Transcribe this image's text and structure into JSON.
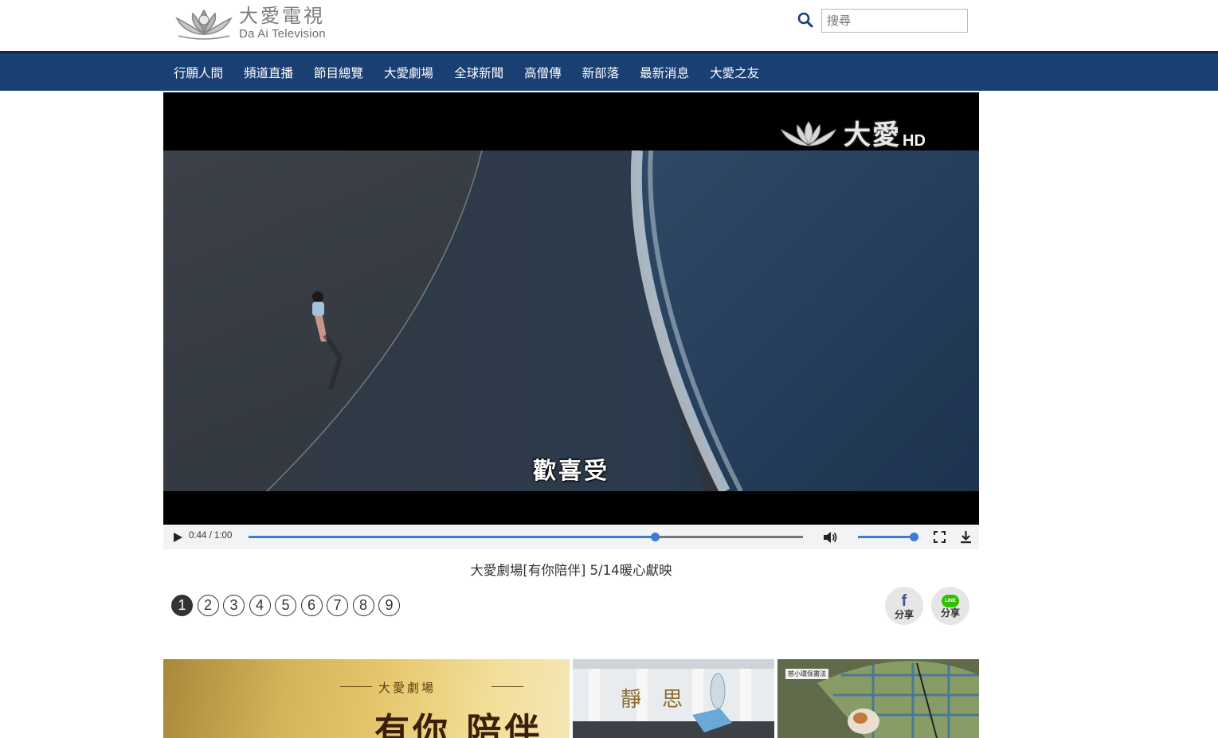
{
  "brand": {
    "name_cn": "大愛電視",
    "name_en": "Da Ai Television"
  },
  "search": {
    "placeholder": "搜尋"
  },
  "nav": {
    "items": [
      "行願人間",
      "頻道直播",
      "節目總覽",
      "大愛劇場",
      "全球新聞",
      "高僧傳",
      "新部落",
      "最新消息",
      "大愛之友"
    ]
  },
  "video": {
    "logo_cn": "大愛",
    "logo_tag": "HD",
    "subtitle": "歡喜受",
    "time_display": "0:44 / 1:00",
    "progress": 0.733,
    "volume": 1.0
  },
  "caption": "大愛劇場[有你陪伴] 5/14暖心獻映",
  "pager": {
    "pages": [
      "1",
      "2",
      "3",
      "4",
      "5",
      "6",
      "7",
      "8",
      "9"
    ],
    "active_index": 0
  },
  "share": {
    "facebook_label": "分享",
    "line_label": "分享",
    "line_badge": "LINE"
  },
  "thumbs": {
    "t1_sub": "大愛劇場",
    "t1_title": "有你 陪伴",
    "t2_sign": "靜思",
    "t3_sign": "慈小環保書法"
  },
  "colors": {
    "nav_bg": "#1a3f73",
    "accent": "#3a7bd5"
  }
}
